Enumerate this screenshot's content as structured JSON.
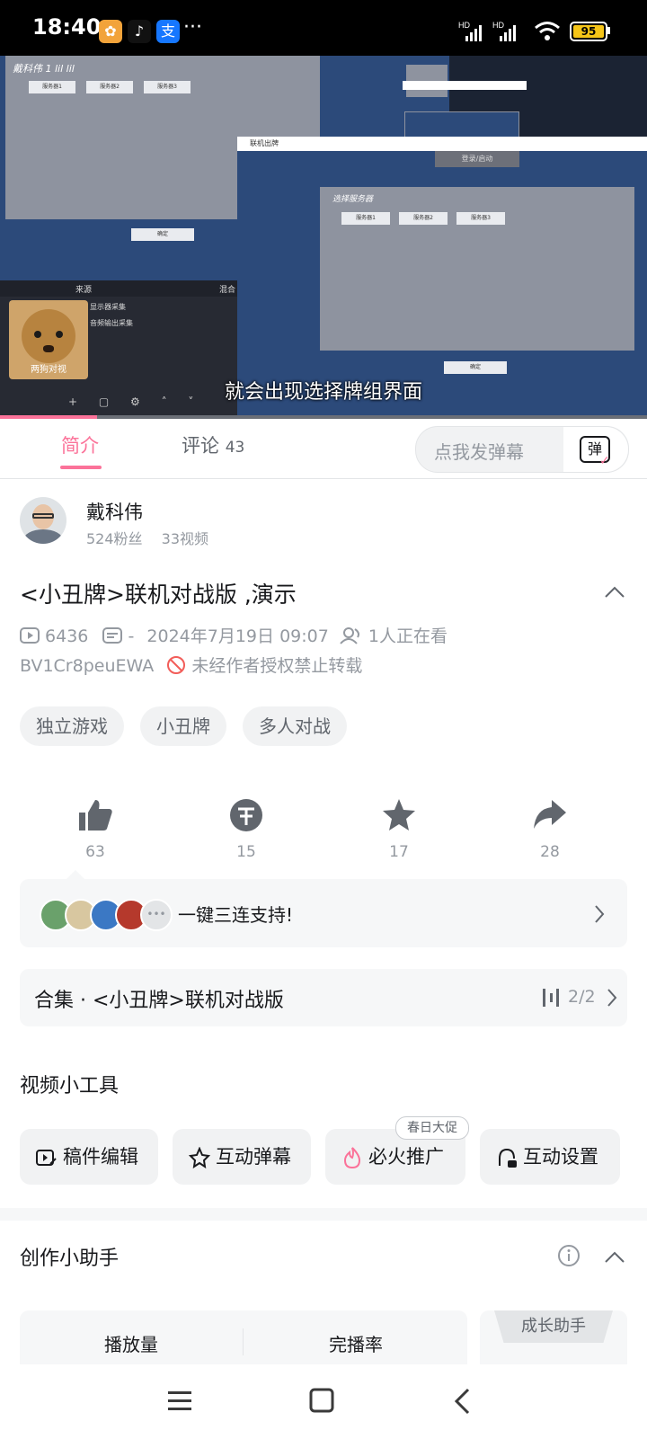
{
  "status_bar": {
    "time": "18:40",
    "more": "···",
    "battery": "95",
    "signal_tag": "HD"
  },
  "video": {
    "subtitle": "就会出现选择牌组界面",
    "sticker_caption": "两狗对视",
    "source_header": "来源",
    "mixer_header": "混合",
    "source_items": [
      "显示器采集",
      "音频输出采集"
    ],
    "select_server_title": "选择服务器",
    "server_buttons": [
      "服务器1",
      "服务器2",
      "服务器3"
    ],
    "confirm": "确定",
    "login_label": "登录/启动",
    "overlay_text": "戴科伟 1 lil lil",
    "window_title": "联机出牌"
  },
  "tabs": {
    "intro": "简介",
    "comments_label": "评论",
    "comments_count": "43",
    "danmaku_placeholder": "点我发弹幕",
    "danmaku_icon_label": "弹"
  },
  "author": {
    "name": "戴科伟",
    "fans": "524粉丝",
    "videos": "33视频"
  },
  "video_info": {
    "title": "<小丑牌>联机对战版 ,演示",
    "plays": "6436",
    "danmaku_count": "-",
    "date": "2024年7月19日 09:07",
    "watching": "1人正在看",
    "bvid": "BV1Cr8peuEWA",
    "copyright": "未经作者授权禁止转载"
  },
  "tags": [
    "独立游戏",
    "小丑牌",
    "多人对战"
  ],
  "actions": {
    "like": "63",
    "coin": "15",
    "favorite": "17",
    "share": "28"
  },
  "triple": {
    "label": "一键三连支持!"
  },
  "collection": {
    "label": "合集 · <小丑牌>联机对战版",
    "progress": "2/2"
  },
  "tools": {
    "title": "视频小工具",
    "items": [
      "稿件编辑",
      "互动弹幕",
      "必火推广",
      "互动设置"
    ],
    "promo_badge": "春日大促"
  },
  "assistant": {
    "title": "创作小助手",
    "metrics": [
      "播放量",
      "完播率"
    ],
    "growth": "成长助手"
  },
  "colors": {
    "accent": "#fb7299",
    "video_bg": "#2c4a7a",
    "grey_panel": "#8e939f"
  }
}
